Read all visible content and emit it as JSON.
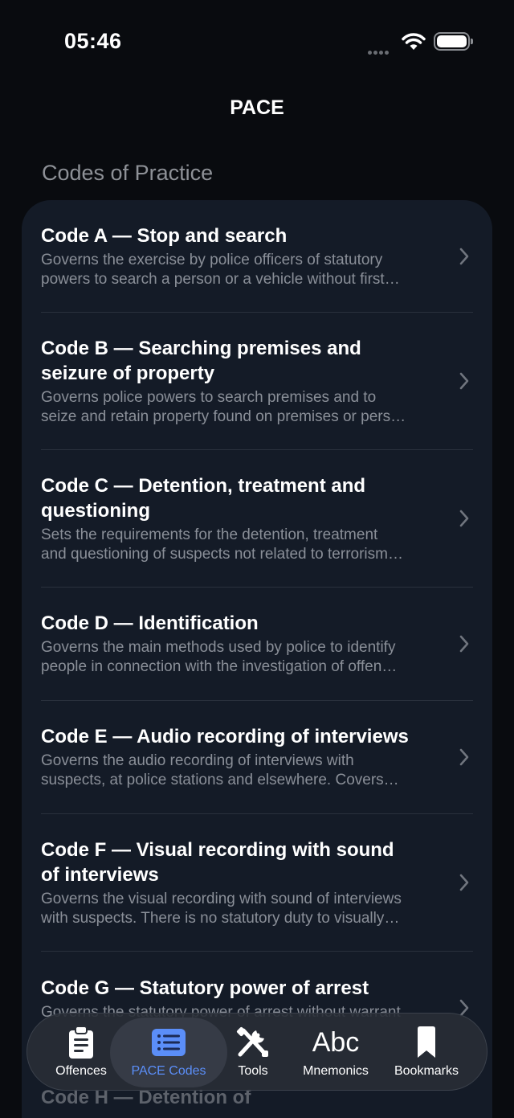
{
  "status": {
    "time": "05:46"
  },
  "nav": {
    "title": "PACE"
  },
  "section": {
    "header": "Codes of Practice"
  },
  "codes": [
    {
      "title": "Code A — Stop and search",
      "desc1": "Governs the exercise by police officers of statutory",
      "desc2": "powers to search a person or a vehicle without first…"
    },
    {
      "title1": "Code B — Searching premises and",
      "title2": "seizure of property",
      "desc1": "Governs police powers to search premises and to",
      "desc2": "seize and retain property found on premises or pers…"
    },
    {
      "title1": "Code C — Detention, treatment and",
      "title2": "questioning",
      "desc1": "Sets the requirements for the detention, treatment",
      "desc2": "and questioning of suspects not related to terrorism…"
    },
    {
      "title": "Code D — Identification",
      "desc1": "Governs the main methods used by police to identify",
      "desc2": "people in connection with the investigation of offen…"
    },
    {
      "title": "Code E — Audio recording of interviews",
      "desc1": "Governs the audio recording of interviews with",
      "desc2": "suspects, at police stations and elsewhere. Covers…"
    },
    {
      "title1": "Code F — Visual recording with sound",
      "title2": "of interviews",
      "desc1": "Governs the visual recording with sound of interviews",
      "desc2": "with suspects. There is no statutory duty to visually…"
    },
    {
      "title": "Code G — Statutory power of arrest",
      "desc1": "Governs the statutory power of arrest without warrant"
    },
    {
      "title": "Code H — Detention of"
    }
  ],
  "tabs": [
    {
      "label": "Offences",
      "icon": "clipboard-icon"
    },
    {
      "label": "PACE Codes",
      "icon": "list-icon",
      "active": true
    },
    {
      "label": "Tools",
      "icon": "tools-icon"
    },
    {
      "label": "Mnemonics",
      "icon": "abc-icon",
      "glyph": "Abc"
    },
    {
      "label": "Bookmarks",
      "icon": "bookmark-icon"
    }
  ],
  "colors": {
    "accent": "#5b8ef8",
    "card": "#141b27",
    "background": "#090b0f"
  }
}
